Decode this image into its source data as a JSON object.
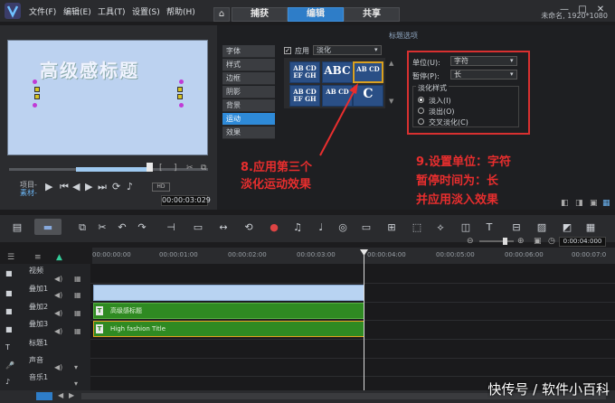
{
  "menu": [
    "文件(F)",
    "编辑(E)",
    "工具(T)",
    "设置(S)",
    "帮助(H)"
  ],
  "tabs": [
    "捕获",
    "编辑",
    "共享"
  ],
  "project_info": "未命名, 1920*1080",
  "preview": {
    "title_text": "高级感标题",
    "project_label": "项目-",
    "clip_label": "素材-",
    "timecode": "00:00:03:029",
    "hd_label": "HD"
  },
  "options": {
    "header": "标题选项",
    "side_items": [
      "字体",
      "样式",
      "边框",
      "阴影",
      "背景",
      "运动",
      "效果"
    ],
    "active_item": "运动",
    "apply_label": "应用",
    "effect_select": "淡化",
    "thumbs": [
      "AB CD EF GH",
      "ABC",
      "AB CD",
      "AB CD EF GH",
      "AB CD",
      "C"
    ],
    "unit_label": "单位(U):",
    "unit_value": "字符",
    "pause_label": "暂停(P):",
    "pause_value": "长",
    "fade_style_label": "淡化样式",
    "fade_in": "淡入(I)",
    "fade_out": "淡出(O)",
    "cross_fade": "交叉淡化(C)"
  },
  "annotations": {
    "step8": [
      "8.应用第三个",
      "淡化运动效果"
    ],
    "step9": [
      "9.设置单位：字符",
      "暂停时间为：长",
      "并应用淡入效果"
    ]
  },
  "timeline": {
    "ruler_ticks": [
      "00:00:00:00",
      "00:00:01:00",
      "00:00:02:00",
      "00:00:03:00",
      "00:00:04:00",
      "00:00:05:00",
      "00:00:06:00",
      "00:00:07:0"
    ],
    "zoom_timecode": "0:00:04:000",
    "tracks": [
      "视频",
      "叠加1",
      "叠加2",
      "叠加3",
      "标题1",
      "声音",
      "音乐1"
    ],
    "clips": {
      "overlay2": "高级感标题",
      "overlay3": "High fashion Title"
    }
  },
  "watermark": "快传号 / 软件小百科",
  "colors": {
    "accent": "#2e7dc8",
    "clip_green": "#2f8a22",
    "annotation_red": "#e82e2e"
  }
}
